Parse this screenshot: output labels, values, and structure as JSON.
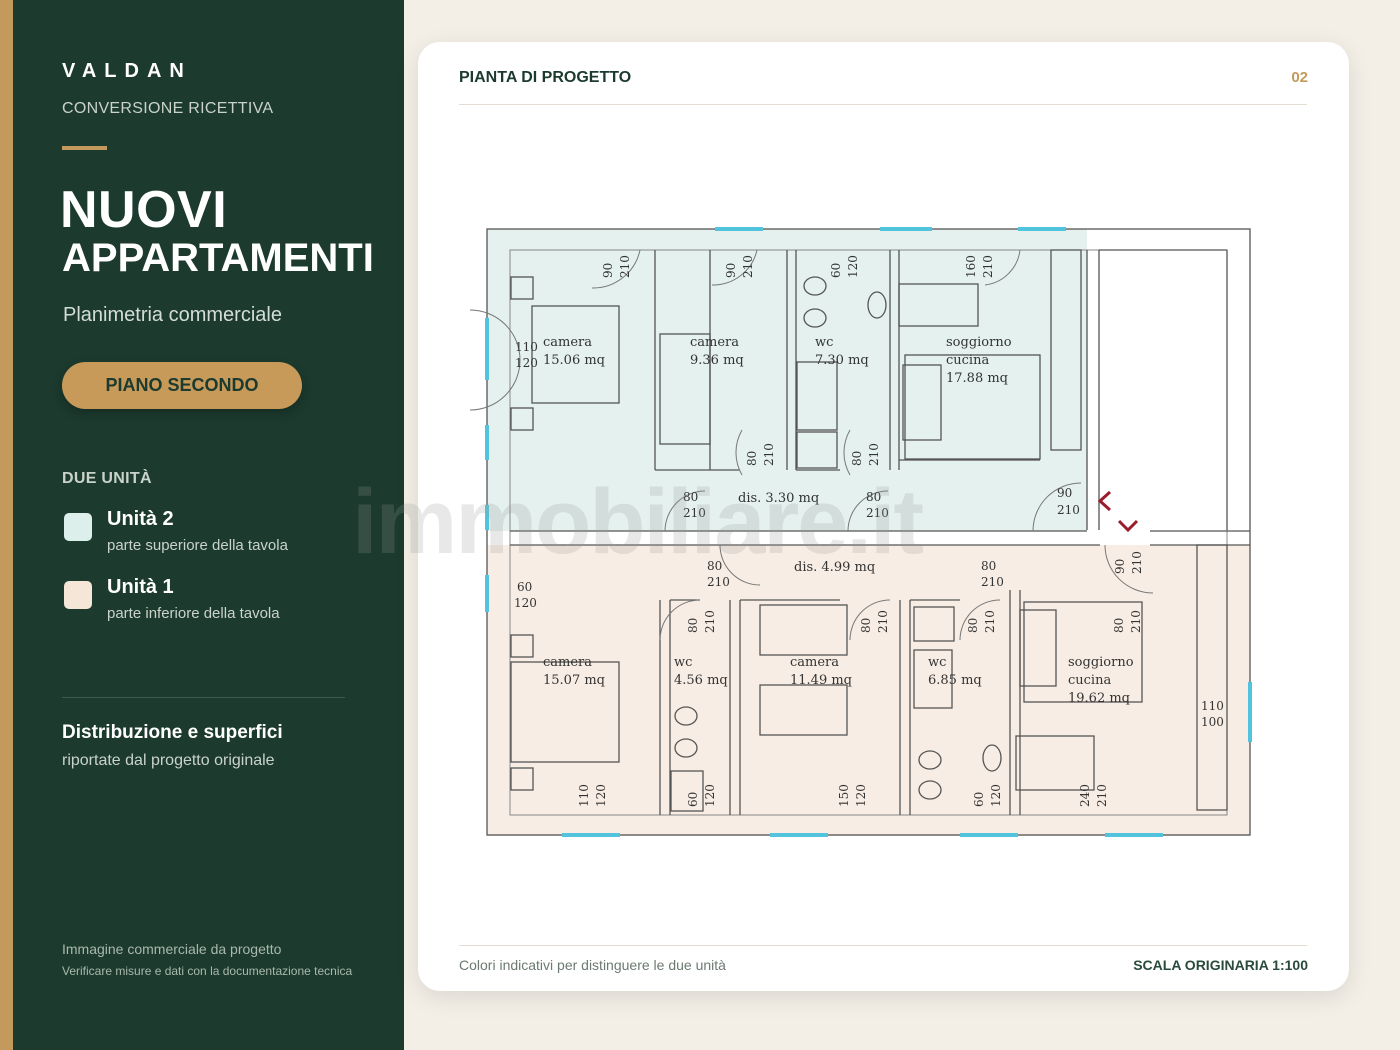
{
  "sidebar": {
    "brand": "VALDAN",
    "brand_sub": "CONVERSIONE RICETTIVA",
    "title_line1": "NUOVI",
    "title_line2": "APPARTAMENTI",
    "subtitle": "Planimetria commerciale",
    "floor_button": "PIANO SECONDO",
    "units_title": "DUE UNITÀ",
    "units": [
      {
        "name": "Unità 2",
        "desc": "parte superiore della tavola",
        "color": "#dcefea"
      },
      {
        "name": "Unità 1",
        "desc": "parte inferiore della tavola",
        "color": "#f5e6d8"
      }
    ],
    "dist_title": "Distribuzione e superfici",
    "dist_sub": "riportate dal progetto originale",
    "footer_line1": "Immagine commerciale da progetto",
    "footer_line2": "Verificare misure e dati con la documentazione tecnica"
  },
  "card": {
    "title": "PIANTA DI PROGETTO",
    "page_number": "02",
    "note": "Colori indicativi per distinguere le due unità",
    "scale": "SCALA ORIGINARIA 1:100"
  },
  "plan": {
    "rooms": [
      {
        "line1": "camera",
        "line2": "15.06 mq"
      },
      {
        "line1": "camera",
        "line2": "9.36 mq"
      },
      {
        "line1": "wc",
        "line2": "7.30 mq"
      },
      {
        "line1": "soggiorno",
        "line2": "cucina",
        "line3": "17.88 mq"
      },
      {
        "line1": "dis. 3.30 mq"
      },
      {
        "line1": "dis. 4.99 mq"
      },
      {
        "line1": "camera",
        "line2": "15.07 mq"
      },
      {
        "line1": "wc",
        "line2": "4.56 mq"
      },
      {
        "line1": "camera",
        "line2": "11.49 mq"
      },
      {
        "line1": "wc",
        "line2": "6.85 mq"
      },
      {
        "line1": "soggiorno",
        "line2": "cucina",
        "line3": "19.62 mq"
      }
    ],
    "dimensions": [
      {
        "a": "90",
        "b": "210"
      },
      {
        "a": "90",
        "b": "210"
      },
      {
        "a": "60",
        "b": "120"
      },
      {
        "a": "160",
        "b": "210"
      },
      {
        "a": "110",
        "b": "120"
      },
      {
        "a": "80",
        "b": "210"
      },
      {
        "a": "80",
        "b": "210"
      },
      {
        "a": "80",
        "b": "210"
      },
      {
        "a": "80",
        "b": "210"
      },
      {
        "a": "90",
        "b": "210"
      },
      {
        "a": "90",
        "b": "210"
      },
      {
        "a": "60",
        "b": "120"
      },
      {
        "a": "80",
        "b": "210"
      },
      {
        "a": "80",
        "b": "210"
      },
      {
        "a": "80",
        "b": "210"
      },
      {
        "a": "80",
        "b": "210"
      },
      {
        "a": "80",
        "b": "210"
      },
      {
        "a": "80",
        "b": "210"
      },
      {
        "a": "110",
        "b": "100"
      },
      {
        "a": "110",
        "b": "120"
      },
      {
        "a": "60",
        "b": "120"
      },
      {
        "a": "150",
        "b": "120"
      },
      {
        "a": "60",
        "b": "120"
      },
      {
        "a": "240",
        "b": "210"
      }
    ]
  },
  "watermark": "immobiliare.it"
}
